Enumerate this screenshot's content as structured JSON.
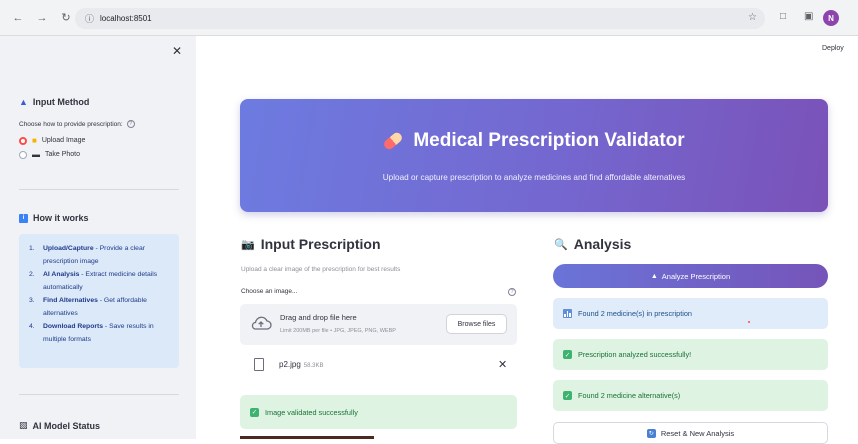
{
  "browser": {
    "url": "localhost:8501",
    "profile_initial": "N"
  },
  "sidebar": {
    "input_method_title": "Input Method",
    "choose_label": "Choose how to provide prescription:",
    "options": [
      {
        "label": "Upload Image",
        "selected": true
      },
      {
        "label": "Take Photo",
        "selected": false
      }
    ],
    "how_title": "How it works",
    "steps": [
      {
        "num": "1.",
        "bold": "Upload/Capture",
        "text": " - Provide a clear prescription image"
      },
      {
        "num": "2.",
        "bold": "AI Analysis",
        "text": " - Extract medicine details automatically"
      },
      {
        "num": "3.",
        "bold": "Find Alternatives",
        "text": " - Get affordable alternatives"
      },
      {
        "num": "4.",
        "bold": "Download Reports",
        "text": " - Save results in multiple formats"
      }
    ],
    "model_status_title": "AI Model Status"
  },
  "header": {
    "deploy_label": "Deploy"
  },
  "hero": {
    "title": "Medical Prescription Validator",
    "subtitle": "Upload or capture prescription to analyze medicines and find affordable alternatives"
  },
  "input_section": {
    "title": "Input Prescription",
    "caption": "Upload a clear image of the prescription for best results",
    "choose_label": "Choose an image...",
    "dropzone_main": "Drag and drop file here",
    "dropzone_limit": "Limit 200MB per file • JPG, JPEG, PNG, WEBP",
    "browse_label": "Browse files",
    "file_name": "p2.jpg",
    "file_size": "58.3KB",
    "validated_msg": "Image validated successfully"
  },
  "analysis": {
    "title": "Analysis",
    "analyze_label": "Analyze Prescription",
    "found_medicines": "Found 2 medicine(s) in prescription",
    "analyzed_msg": "Prescription analyzed successfully!",
    "found_alternatives": "Found 2 medicine alternative(s)",
    "reset_label": "Reset & New Analysis"
  },
  "colors": {
    "accent": "#ff4b4b",
    "hero_start": "#6d7be0",
    "hero_end": "#7a52b8",
    "success_bg": "#dff3e3",
    "info_bg": "#e1ecfa"
  }
}
